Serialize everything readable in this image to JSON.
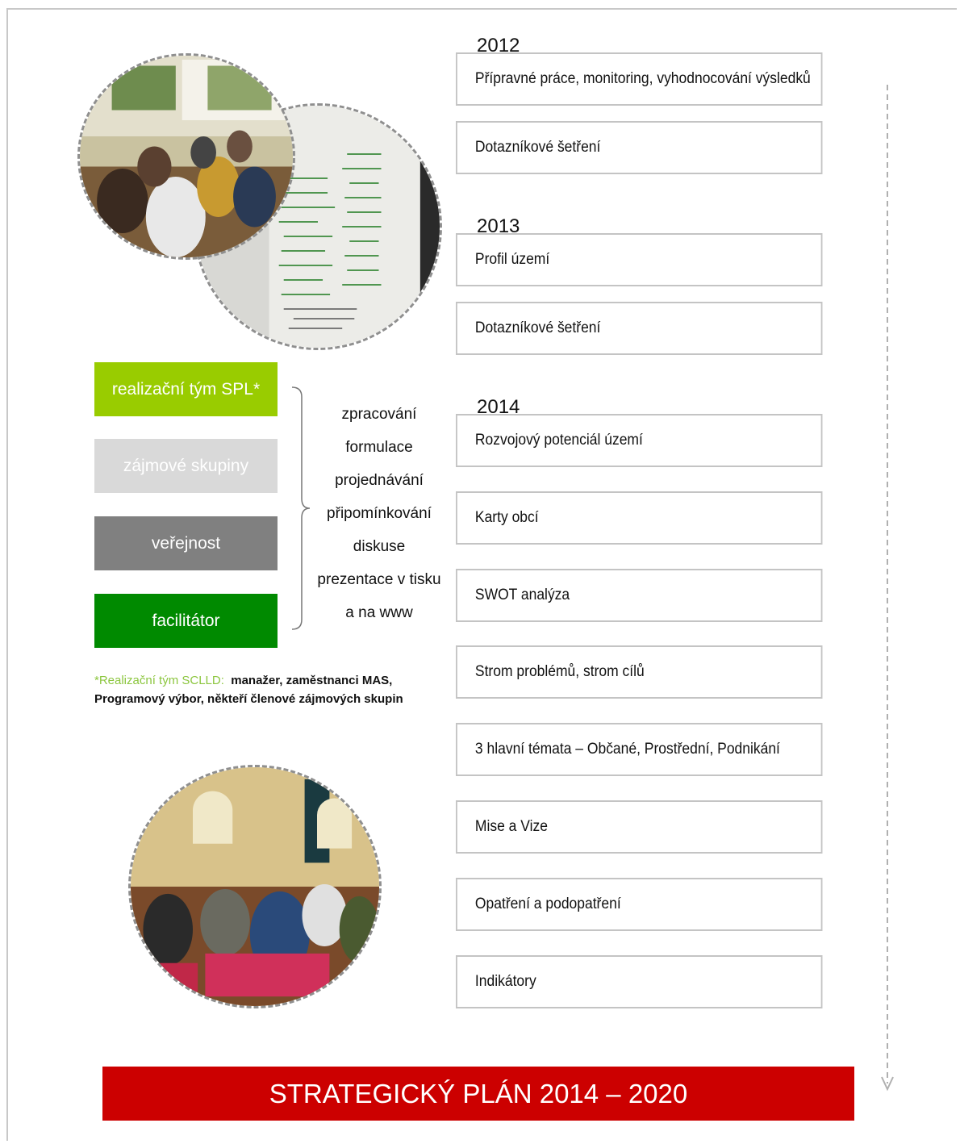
{
  "timeline": [
    {
      "year": "2012",
      "steps": [
        "Přípravné práce, monitoring, vyhodnocování výsledků",
        "Dotazníkové šetření"
      ]
    },
    {
      "year": "2013",
      "steps": [
        "Profil území",
        "Dotazníkové šetření"
      ]
    },
    {
      "year": "2014",
      "steps": [
        "Rozvojový potenciál území",
        "Karty obcí",
        "SWOT analýza",
        "Strom problémů, strom cílů",
        "3 hlavní témata – Občané, Prostřední, Podnikání",
        "Mise a Vize",
        "Opatření a podopatření",
        "Indikátory"
      ]
    }
  ],
  "roles": [
    {
      "label": "realizační tým SPL*",
      "color": "#99cc00"
    },
    {
      "label": "zájmové skupiny",
      "color": "#d9d9d9"
    },
    {
      "label": "veřejnost",
      "color": "#808080"
    },
    {
      "label": "facilitátor",
      "color": "#008a00"
    }
  ],
  "activities": [
    "zpracování",
    "formulace",
    "projednávání",
    "připomínkování",
    "diskuse",
    "prezentace v tisku",
    "a na www"
  ],
  "note": {
    "highlight": "*Realizační tým SCLLD:",
    "text": "manažer, zaměstnanci MAS, Programový výbor, někteří členové zájmových skupin"
  },
  "banner": "STRATEGICKÝ PLÁN 2014 – 2020",
  "colors": {
    "banner": "#cc0000",
    "box_border": "#c4c4c4",
    "arrow": "#b0b0b0"
  }
}
